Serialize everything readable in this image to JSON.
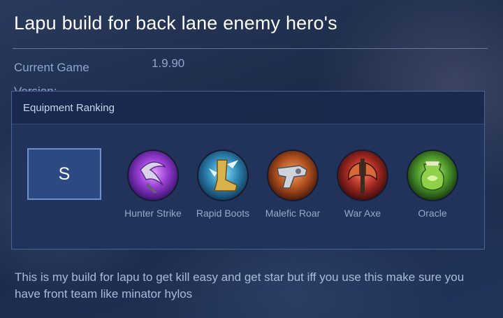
{
  "post": {
    "title": "Lapu build for back lane enemy hero's",
    "meta_label": "Current Game Version:",
    "meta_value": "1.9.90",
    "description": "This is my build for lapu to get kill easy and get star but iff you use this make sure you have front team like minator hylos"
  },
  "equipment": {
    "heading": "Equipment Ranking",
    "tier": "S",
    "items": [
      {
        "name": "Hunter Strike",
        "icon": "hunter-strike-icon"
      },
      {
        "name": "Rapid Boots",
        "icon": "rapid-boots-icon"
      },
      {
        "name": "Malefic Roar",
        "icon": "malefic-roar-icon"
      },
      {
        "name": "War Axe",
        "icon": "war-axe-icon"
      },
      {
        "name": "Oracle",
        "icon": "oracle-icon"
      }
    ]
  },
  "colors": {
    "panel_border": "#4a6496",
    "tier_border": "#6f8fca",
    "text_muted": "#8ea6cc"
  }
}
